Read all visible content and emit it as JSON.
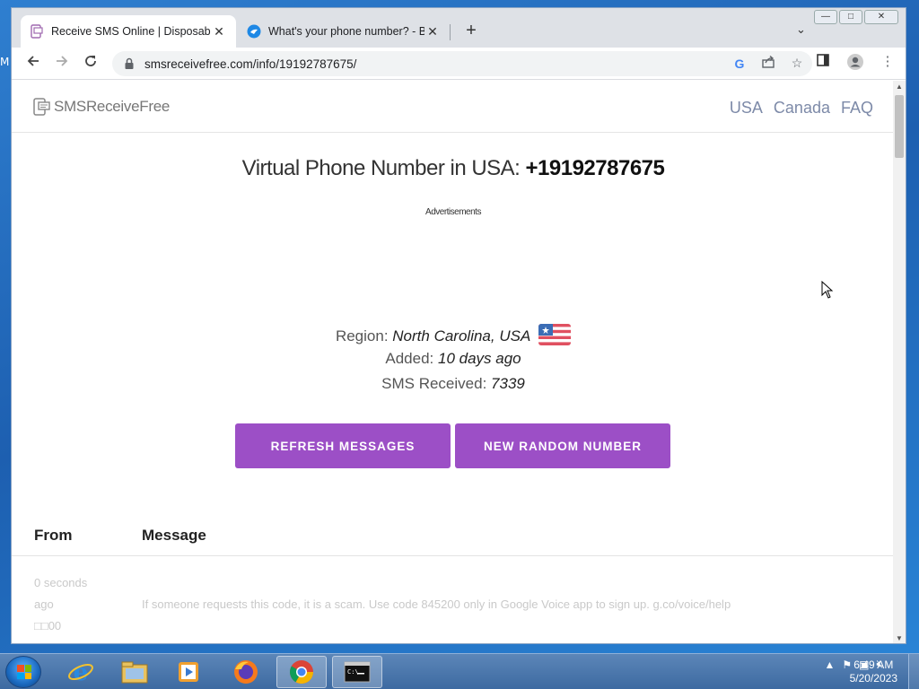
{
  "desktop": {
    "edge_text": "M"
  },
  "browser": {
    "tabs": [
      {
        "title": "Receive SMS Online | Disposable",
        "close": "✕",
        "active": true
      },
      {
        "title": "What's your phone number? - Bl",
        "close": "✕",
        "active": false
      }
    ],
    "new_tab": "+",
    "tab_search": "⌄",
    "window_controls": [
      "—",
      "□",
      "✕"
    ],
    "url": "smsreceivefree.com/info/19192787675/"
  },
  "site": {
    "logo_text": "SMSReceiveFree",
    "nav": [
      "USA",
      "Canada",
      "FAQ"
    ],
    "headline_prefix": "Virtual Phone Number in USA: ",
    "phone_number": "+19192787675",
    "ads_label": "Advertisements",
    "region_label": "Region: ",
    "region_value": "North Carolina, USA",
    "added_label": "Added: ",
    "added_value": "10 days ago",
    "sms_label": "SMS Received: ",
    "sms_value": "7339",
    "refresh_button": "REFRESH MESSAGES",
    "random_button": "NEW RANDOM NUMBER",
    "table_headers": [
      "From",
      "Message"
    ],
    "messages": [
      {
        "time_line1": "0 seconds",
        "time_line2": "ago",
        "from": "□□00",
        "text": "If someone requests this code, it is a scam. Use code 845200 only in Google Voice app to sign up. g.co/voice/help"
      }
    ]
  },
  "taskbar": {
    "clock_time": "6:49 AM",
    "clock_date": "5/20/2023"
  },
  "colors": {
    "button": "#9c4fc6",
    "nav_link": "#7d8aa8",
    "taskbar": "#3d6aa1"
  }
}
